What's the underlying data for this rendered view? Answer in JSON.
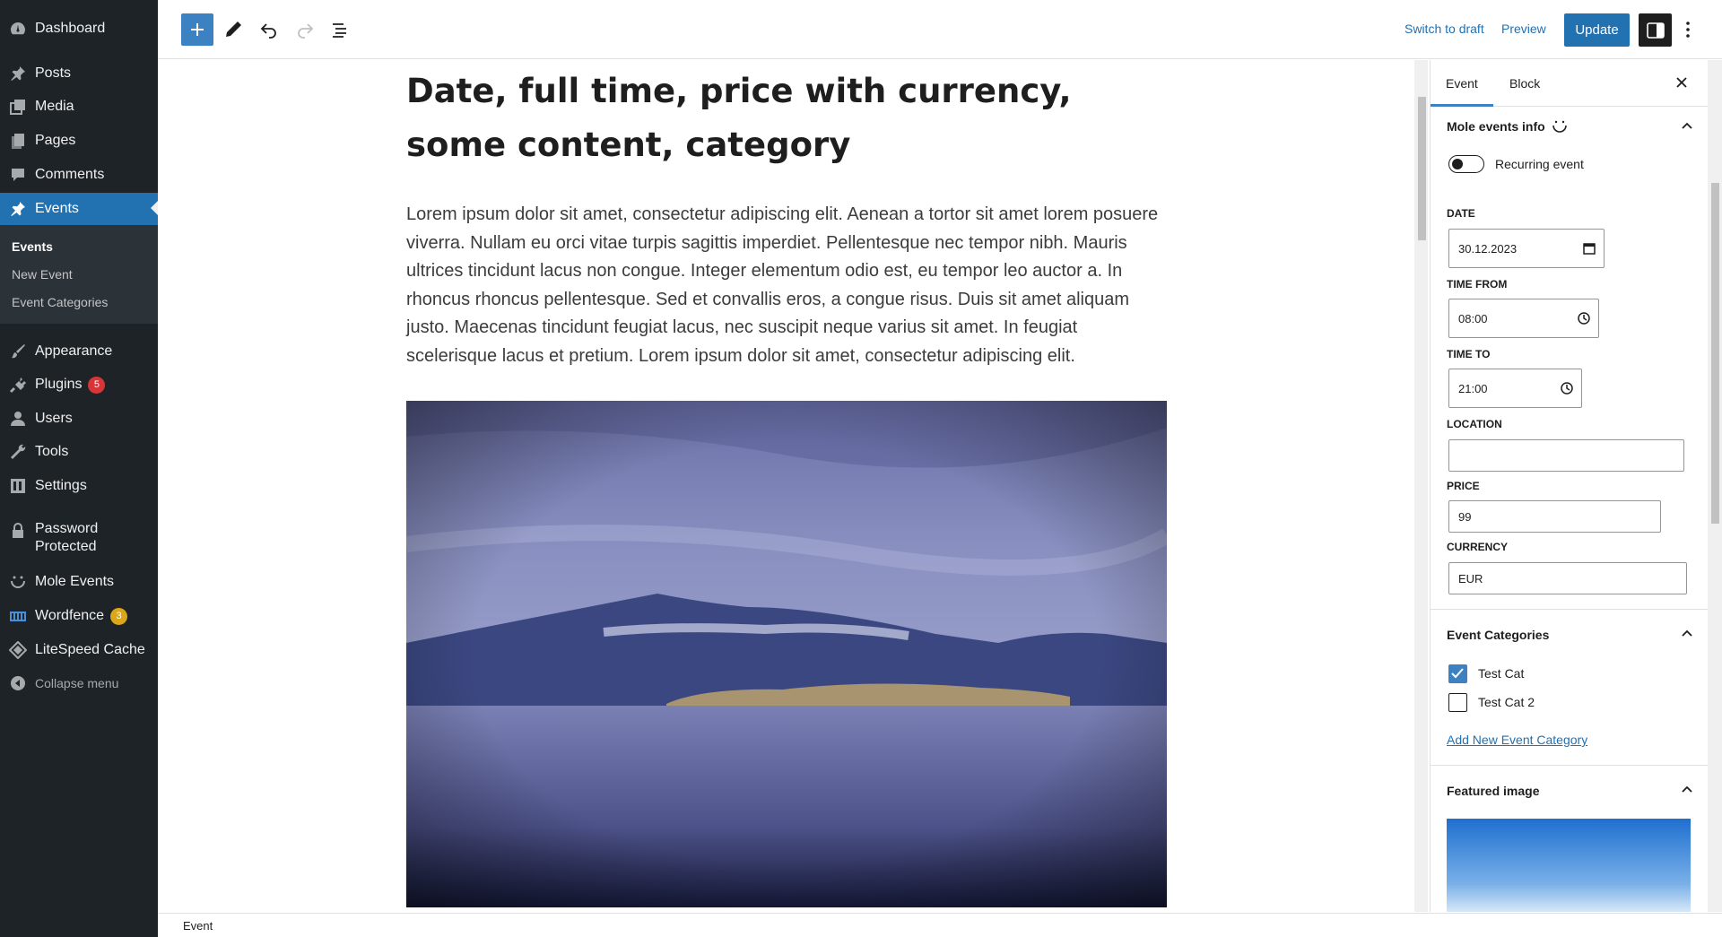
{
  "admin_menu": {
    "items": [
      {
        "label": "Dashboard",
        "icon": "dashboard-icon"
      },
      {
        "label": "Posts",
        "icon": "pin-icon"
      },
      {
        "label": "Media",
        "icon": "media-icon"
      },
      {
        "label": "Pages",
        "icon": "pages-icon"
      },
      {
        "label": "Comments",
        "icon": "comment-icon"
      },
      {
        "label": "Events",
        "icon": "pin-icon"
      },
      {
        "label": "Appearance",
        "icon": "brush-icon"
      },
      {
        "label": "Plugins",
        "icon": "plugin-icon",
        "badge": "5"
      },
      {
        "label": "Users",
        "icon": "user-icon"
      },
      {
        "label": "Tools",
        "icon": "wrench-icon"
      },
      {
        "label": "Settings",
        "icon": "settings-icon"
      },
      {
        "label": "Password Protected",
        "icon": "lock-icon"
      },
      {
        "label": "Mole Events",
        "icon": "mole-icon"
      },
      {
        "label": "Wordfence",
        "icon": "wordfence-icon",
        "badge": "3"
      },
      {
        "label": "LiteSpeed Cache",
        "icon": "diamond-icon"
      }
    ],
    "submenu": [
      "Events",
      "New Event",
      "Event Categories"
    ],
    "collapse_label": "Collapse menu"
  },
  "toolbar": {
    "switch_to_draft": "Switch to draft",
    "preview": "Preview",
    "update": "Update"
  },
  "post": {
    "title": "Date, full time, price with currency, some content, category",
    "body": "Lorem ipsum dolor sit amet, consectetur adipiscing elit. Aenean a tortor sit amet lorem posuere viverra. Nullam eu orci vitae turpis sagittis imperdiet. Pellentesque nec tempor nibh. Mauris ultrices tincidunt lacus non congue. Integer elementum odio est, eu tempor leo auctor a. In rhoncus rhoncus pellentesque. Sed et convallis eros, a congue risus. Duis sit amet aliquam justo. Maecenas tincidunt feugiat lacus, nec suscipit neque varius sit amet. In feugiat scelerisque lacus et pretium. Lorem ipsum dolor sit amet, consectetur adipiscing elit."
  },
  "panel": {
    "tabs": [
      "Event",
      "Block"
    ],
    "mole_section_title": "Mole events info",
    "recurring_label": "Recurring event",
    "fields": {
      "date_label": "DATE",
      "date_value": "30.12.2023",
      "time_from_label": "TIME FROM",
      "time_from_value": "08:00",
      "time_to_label": "TIME TO",
      "time_to_value": "21:00",
      "location_label": "LOCATION",
      "location_value": "",
      "price_label": "PRICE",
      "price_value": "99",
      "currency_label": "CURRENCY",
      "currency_value": "EUR"
    },
    "categories_title": "Event Categories",
    "categories": [
      {
        "label": "Test Cat",
        "checked": true
      },
      {
        "label": "Test Cat 2",
        "checked": false
      }
    ],
    "add_category_link": "Add New Event Category",
    "featured_image_title": "Featured image"
  },
  "footer": {
    "breadcrumb": "Event"
  },
  "colors": {
    "admin_bg": "#1d2327",
    "accent": "#2271b1",
    "badge_red": "#d63638",
    "badge_yellow": "#dba617"
  }
}
